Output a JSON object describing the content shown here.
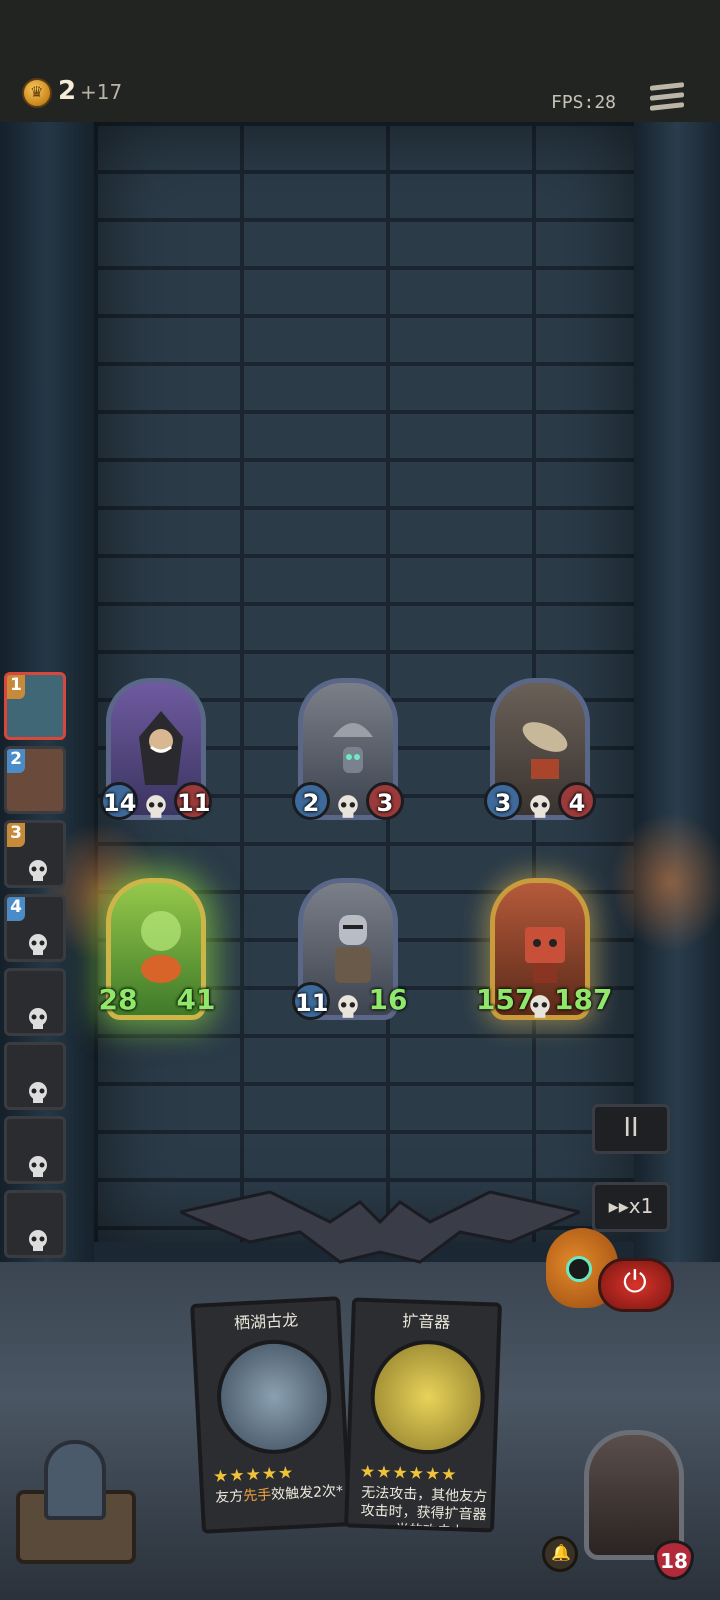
{
  "top_bar": {
    "gold": "2",
    "gold_increment": "+17",
    "fps": "FPS:28"
  },
  "turn_queue": [
    {
      "order": "1",
      "state": "active"
    },
    {
      "order": "2",
      "state": "next"
    },
    {
      "order": "3",
      "state": "waiting"
    },
    {
      "order": "4",
      "state": "waiting"
    },
    {
      "order": "",
      "state": "waiting"
    },
    {
      "order": "",
      "state": "waiting"
    },
    {
      "order": "",
      "state": "waiting"
    },
    {
      "order": "",
      "state": "waiting"
    }
  ],
  "board": {
    "enemy_row": [
      {
        "name": "hooded-rogue",
        "attack": "14",
        "health": "11"
      },
      {
        "name": "robot-bell",
        "attack": "2",
        "health": "3"
      },
      {
        "name": "rocket-crate",
        "attack": "3",
        "health": "4"
      }
    ],
    "player_row": [
      {
        "name": "green-spirit",
        "attack": "28",
        "health": "41"
      },
      {
        "name": "armored-knight",
        "attack": "11",
        "health": "16"
      },
      {
        "name": "red-golem",
        "attack": "157",
        "health": "187"
      }
    ]
  },
  "controls": {
    "pause_label": "II",
    "speed_label": "▸▸x1"
  },
  "hand": [
    {
      "title": "栖湖古龙",
      "stars": "★★★★★",
      "desc_prefix": "友方",
      "desc_keyword": "先手",
      "desc_suffix": "效触发2次*"
    },
    {
      "title": "扩音器",
      "stars": "★★★★★★",
      "desc_full": "无法攻击，其他友方攻击时，获得扩音器一半的攻击力"
    }
  ],
  "hero": {
    "health": "18"
  },
  "colors": {
    "gold_coin": "#f7c85a",
    "buffed_stat": "#8fe86a",
    "keyword": "#f0a040",
    "power_button": "#d8332a"
  }
}
